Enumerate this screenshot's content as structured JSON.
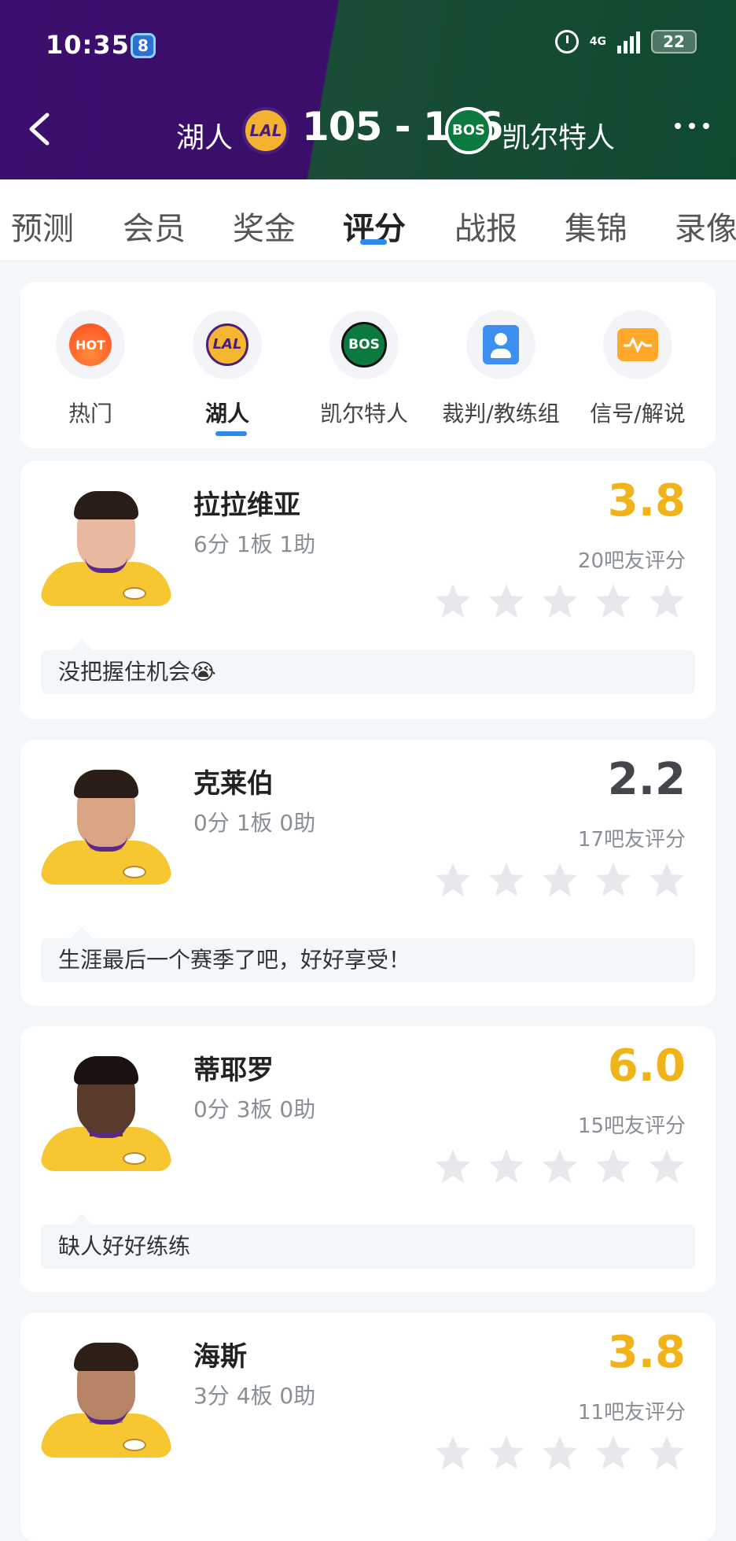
{
  "status_bar": {
    "time": "10:35",
    "badge": "8",
    "network": "4G",
    "battery": "22"
  },
  "game": {
    "team_home": "湖人",
    "team_home_logo": "LAL",
    "score": "105 - 126",
    "team_away_logo": "BOS",
    "team_away": "凯尔特人"
  },
  "tabs": [
    "预测",
    "会员",
    "奖金",
    "评分",
    "战报",
    "集锦",
    "录像"
  ],
  "active_tab": "评分",
  "categories": [
    {
      "label": "热门",
      "icon": "hot-icon",
      "badge": "HOT"
    },
    {
      "label": "湖人",
      "icon": "lakers-logo-icon",
      "badge": "LAL"
    },
    {
      "label": "凯尔特人",
      "icon": "celtics-logo-icon",
      "badge": "BOS"
    },
    {
      "label": "裁判/教练组",
      "icon": "referee-icon"
    },
    {
      "label": "信号/解说",
      "icon": "video-signal-icon"
    }
  ],
  "players": [
    {
      "name": "拉拉维亚",
      "stats": "6分 1板 1助",
      "score": "3.8",
      "count": "20吧友评分",
      "comment": "没把握住机会😭"
    },
    {
      "name": "克莱伯",
      "stats": "0分 1板 0助",
      "score": "2.2",
      "count": "17吧友评分",
      "comment": "生涯最后一个赛季了吧，好好享受！"
    },
    {
      "name": "蒂耶罗",
      "stats": "0分 3板 0助",
      "score": "6.0",
      "count": "15吧友评分",
      "comment": "缺人好好练练"
    },
    {
      "name": "海斯",
      "stats": "3分 4板 0助",
      "score": "3.8",
      "count": "11吧友评分",
      "comment": ""
    }
  ],
  "colors": {
    "accent": "#2e8ae6",
    "score_high": "#f0b31a",
    "score_low": "#43464b",
    "lakers_purple": "#3c0f6e",
    "celtics_green": "#0f4a2f"
  }
}
